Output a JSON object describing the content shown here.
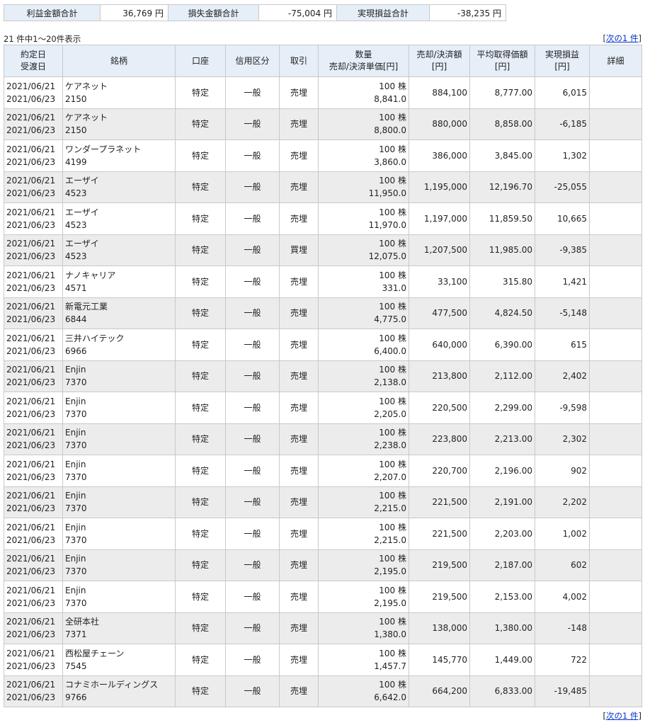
{
  "summary": {
    "profit_label": "利益金額合計",
    "profit_value": "36,769 円",
    "loss_label": "損失金額合計",
    "loss_value": "-75,004 円",
    "realized_label": "実現損益合計",
    "realized_value": "-38,235 円"
  },
  "meta": {
    "count_text": "21 件中1～20件表示",
    "pager_open": "[",
    "next_link": "次の1 件",
    "pager_close": "]"
  },
  "headers": {
    "date1": "約定日",
    "date2": "受渡日",
    "name": "銘柄",
    "account": "口座",
    "credit": "信用区分",
    "trade": "取引",
    "qty1": "数量",
    "qty2": "売却/決済単価[円]",
    "amount1": "売却/決済額",
    "amount2": "[円]",
    "avg1": "平均取得価額",
    "avg2": "[円]",
    "pl1": "実現損益",
    "pl2": "[円]",
    "detail": "詳細"
  },
  "rows": [
    {
      "trade_date": "2021/06/21",
      "settle_date": "2021/06/23",
      "name": "ケアネット",
      "code": "2150",
      "account": "特定",
      "credit": "一般",
      "trade": "売埋",
      "qty": "100 株",
      "price": "8,841.0",
      "amount": "884,100",
      "avg": "8,777.00",
      "pl": "6,015"
    },
    {
      "trade_date": "2021/06/21",
      "settle_date": "2021/06/23",
      "name": "ケアネット",
      "code": "2150",
      "account": "特定",
      "credit": "一般",
      "trade": "売埋",
      "qty": "100 株",
      "price": "8,800.0",
      "amount": "880,000",
      "avg": "8,858.00",
      "pl": "-6,185"
    },
    {
      "trade_date": "2021/06/21",
      "settle_date": "2021/06/23",
      "name": "ワンダープラネット",
      "code": "4199",
      "account": "特定",
      "credit": "一般",
      "trade": "売埋",
      "qty": "100 株",
      "price": "3,860.0",
      "amount": "386,000",
      "avg": "3,845.00",
      "pl": "1,302"
    },
    {
      "trade_date": "2021/06/21",
      "settle_date": "2021/06/23",
      "name": "エーザイ",
      "code": "4523",
      "account": "特定",
      "credit": "一般",
      "trade": "売埋",
      "qty": "100 株",
      "price": "11,950.0",
      "amount": "1,195,000",
      "avg": "12,196.70",
      "pl": "-25,055"
    },
    {
      "trade_date": "2021/06/21",
      "settle_date": "2021/06/23",
      "name": "エーザイ",
      "code": "4523",
      "account": "特定",
      "credit": "一般",
      "trade": "売埋",
      "qty": "100 株",
      "price": "11,970.0",
      "amount": "1,197,000",
      "avg": "11,859.50",
      "pl": "10,665"
    },
    {
      "trade_date": "2021/06/21",
      "settle_date": "2021/06/23",
      "name": "エーザイ",
      "code": "4523",
      "account": "特定",
      "credit": "一般",
      "trade": "買埋",
      "qty": "100 株",
      "price": "12,075.0",
      "amount": "1,207,500",
      "avg": "11,985.00",
      "pl": "-9,385"
    },
    {
      "trade_date": "2021/06/21",
      "settle_date": "2021/06/23",
      "name": "ナノキャリア",
      "code": "4571",
      "account": "特定",
      "credit": "一般",
      "trade": "売埋",
      "qty": "100 株",
      "price": "331.0",
      "amount": "33,100",
      "avg": "315.80",
      "pl": "1,421"
    },
    {
      "trade_date": "2021/06/21",
      "settle_date": "2021/06/23",
      "name": "新電元工業",
      "code": "6844",
      "account": "特定",
      "credit": "一般",
      "trade": "売埋",
      "qty": "100 株",
      "price": "4,775.0",
      "amount": "477,500",
      "avg": "4,824.50",
      "pl": "-5,148"
    },
    {
      "trade_date": "2021/06/21",
      "settle_date": "2021/06/23",
      "name": "三井ハイテック",
      "code": "6966",
      "account": "特定",
      "credit": "一般",
      "trade": "売埋",
      "qty": "100 株",
      "price": "6,400.0",
      "amount": "640,000",
      "avg": "6,390.00",
      "pl": "615"
    },
    {
      "trade_date": "2021/06/21",
      "settle_date": "2021/06/23",
      "name": "Enjin",
      "code": "7370",
      "account": "特定",
      "credit": "一般",
      "trade": "売埋",
      "qty": "100 株",
      "price": "2,138.0",
      "amount": "213,800",
      "avg": "2,112.00",
      "pl": "2,402"
    },
    {
      "trade_date": "2021/06/21",
      "settle_date": "2021/06/23",
      "name": "Enjin",
      "code": "7370",
      "account": "特定",
      "credit": "一般",
      "trade": "売埋",
      "qty": "100 株",
      "price": "2,205.0",
      "amount": "220,500",
      "avg": "2,299.00",
      "pl": "-9,598"
    },
    {
      "trade_date": "2021/06/21",
      "settle_date": "2021/06/23",
      "name": "Enjin",
      "code": "7370",
      "account": "特定",
      "credit": "一般",
      "trade": "売埋",
      "qty": "100 株",
      "price": "2,238.0",
      "amount": "223,800",
      "avg": "2,213.00",
      "pl": "2,302"
    },
    {
      "trade_date": "2021/06/21",
      "settle_date": "2021/06/23",
      "name": "Enjin",
      "code": "7370",
      "account": "特定",
      "credit": "一般",
      "trade": "売埋",
      "qty": "100 株",
      "price": "2,207.0",
      "amount": "220,700",
      "avg": "2,196.00",
      "pl": "902"
    },
    {
      "trade_date": "2021/06/21",
      "settle_date": "2021/06/23",
      "name": "Enjin",
      "code": "7370",
      "account": "特定",
      "credit": "一般",
      "trade": "売埋",
      "qty": "100 株",
      "price": "2,215.0",
      "amount": "221,500",
      "avg": "2,191.00",
      "pl": "2,202"
    },
    {
      "trade_date": "2021/06/21",
      "settle_date": "2021/06/23",
      "name": "Enjin",
      "code": "7370",
      "account": "特定",
      "credit": "一般",
      "trade": "売埋",
      "qty": "100 株",
      "price": "2,215.0",
      "amount": "221,500",
      "avg": "2,203.00",
      "pl": "1,002"
    },
    {
      "trade_date": "2021/06/21",
      "settle_date": "2021/06/23",
      "name": "Enjin",
      "code": "7370",
      "account": "特定",
      "credit": "一般",
      "trade": "売埋",
      "qty": "100 株",
      "price": "2,195.0",
      "amount": "219,500",
      "avg": "2,187.00",
      "pl": "602"
    },
    {
      "trade_date": "2021/06/21",
      "settle_date": "2021/06/23",
      "name": "Enjin",
      "code": "7370",
      "account": "特定",
      "credit": "一般",
      "trade": "売埋",
      "qty": "100 株",
      "price": "2,195.0",
      "amount": "219,500",
      "avg": "2,153.00",
      "pl": "4,002"
    },
    {
      "trade_date": "2021/06/21",
      "settle_date": "2021/06/23",
      "name": "全研本社",
      "code": "7371",
      "account": "特定",
      "credit": "一般",
      "trade": "売埋",
      "qty": "100 株",
      "price": "1,380.0",
      "amount": "138,000",
      "avg": "1,380.00",
      "pl": "-148"
    },
    {
      "trade_date": "2021/06/21",
      "settle_date": "2021/06/23",
      "name": "西松屋チェーン",
      "code": "7545",
      "account": "特定",
      "credit": "一般",
      "trade": "売埋",
      "qty": "100 株",
      "price": "1,457.7",
      "amount": "145,770",
      "avg": "1,449.00",
      "pl": "722"
    },
    {
      "trade_date": "2021/06/21",
      "settle_date": "2021/06/23",
      "name": "コナミホールディングス",
      "code": "9766",
      "account": "特定",
      "credit": "一般",
      "trade": "売埋",
      "qty": "100 株",
      "price": "6,642.0",
      "amount": "664,200",
      "avg": "6,833.00",
      "pl": "-19,485"
    }
  ]
}
